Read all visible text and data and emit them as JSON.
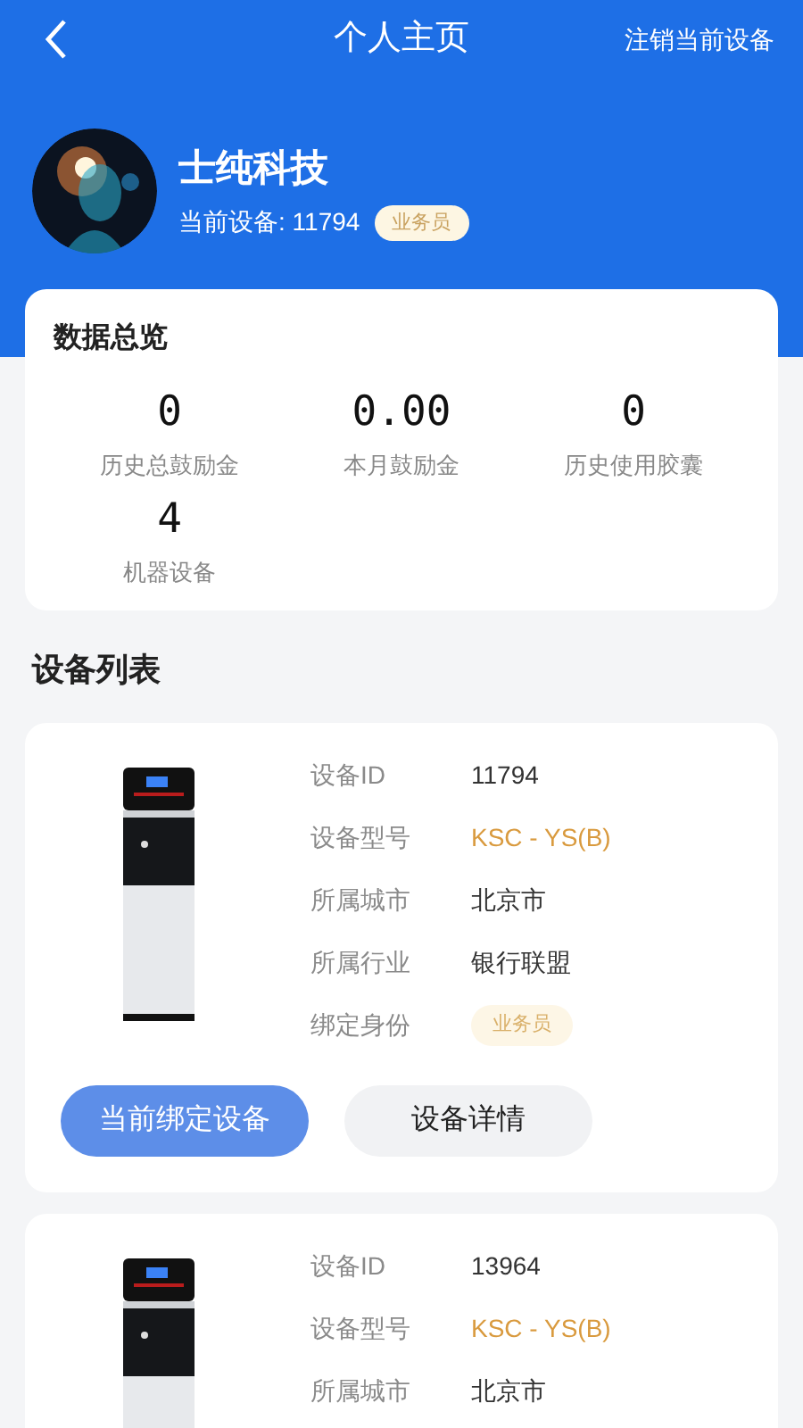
{
  "nav": {
    "title": "个人主页",
    "action": "注销当前设备"
  },
  "profile": {
    "name": "士纯科技",
    "device_label": "当前设备: 11794",
    "role": "业务员"
  },
  "overview": {
    "title": "数据总览",
    "stats": [
      {
        "value": "0",
        "label": "历史总鼓励金"
      },
      {
        "value": "0.00",
        "label": "本月鼓励金"
      },
      {
        "value": "0",
        "label": "历史使用胶囊"
      },
      {
        "value": "4",
        "label": "机器设备"
      }
    ]
  },
  "device_list": {
    "title": "设备列表",
    "devices": [
      {
        "fields": [
          {
            "label": "设备ID",
            "value": "11794",
            "kind": "text"
          },
          {
            "label": "设备型号",
            "value": "KSC - YS(B)",
            "kind": "model"
          },
          {
            "label": "所属城市",
            "value": "北京市",
            "kind": "text"
          },
          {
            "label": "所属行业",
            "value": "银行联盟",
            "kind": "text"
          },
          {
            "label": "绑定身份",
            "value": "业务员",
            "kind": "badge"
          }
        ],
        "buttons": [
          {
            "label": "当前绑定设备",
            "kind": "primary"
          },
          {
            "label": "设备详情",
            "kind": "secondary"
          }
        ]
      },
      {
        "fields": [
          {
            "label": "设备ID",
            "value": "13964",
            "kind": "text"
          },
          {
            "label": "设备型号",
            "value": "KSC - YS(B)",
            "kind": "model"
          },
          {
            "label": "所属城市",
            "value": "北京市",
            "kind": "text"
          }
        ]
      }
    ]
  }
}
